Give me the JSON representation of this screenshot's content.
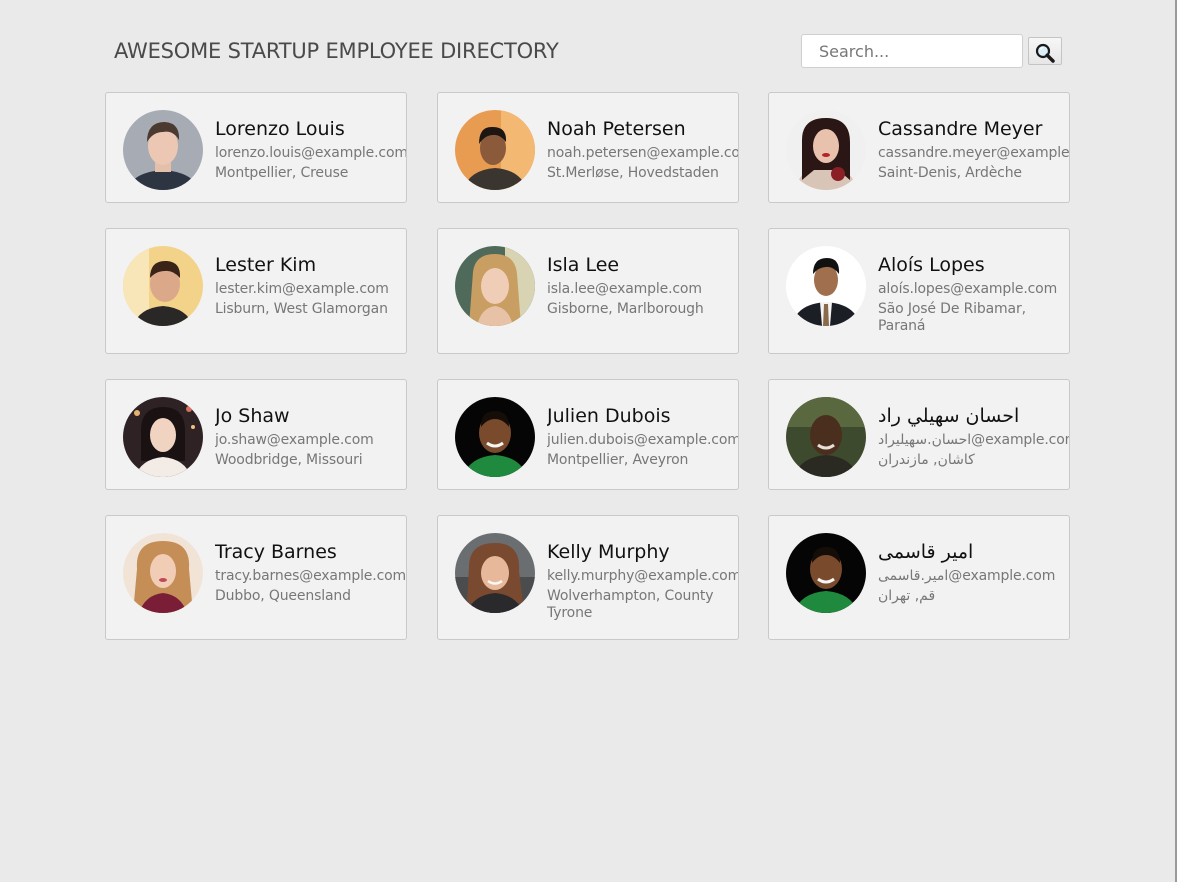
{
  "header": {
    "title": "AWESOME STARTUP EMPLOYEE DIRECTORY",
    "search_placeholder": "Search...",
    "search_button_icon": "magnifier-icon"
  },
  "employees": [
    {
      "name": "Lorenzo Louis",
      "email": "lorenzo.louis@example.com",
      "location": "Montpellier, Creuse"
    },
    {
      "name": "Noah Petersen",
      "email": "noah.petersen@example.com",
      "location": "St.Merløse, Hovedstaden"
    },
    {
      "name": "Cassandre Meyer",
      "email": "cassandre.meyer@example.com",
      "location": "Saint-Denis, Ardèche"
    },
    {
      "name": "Lester Kim",
      "email": "lester.kim@example.com",
      "location": "Lisburn, West Glamorgan"
    },
    {
      "name": "Isla Lee",
      "email": "isla.lee@example.com",
      "location": "Gisborne, Marlborough"
    },
    {
      "name": "Aloís Lopes",
      "email": "aloís.lopes@example.com",
      "location": "São José De Ribamar, Paraná"
    },
    {
      "name": "Jo Shaw",
      "email": "jo.shaw@example.com",
      "location": "Woodbridge, Missouri"
    },
    {
      "name": "Julien Dubois",
      "email": "julien.dubois@example.com",
      "location": "Montpellier, Aveyron"
    },
    {
      "name": "احسان سهيلي راد",
      "email": "احسان.سهیلیراد@example.com",
      "location": "كاشان, مازندران"
    },
    {
      "name": "Tracy Barnes",
      "email": "tracy.barnes@example.com",
      "location": "Dubbo, Queensland"
    },
    {
      "name": "Kelly Murphy",
      "email": "kelly.murphy@example.com",
      "location": "Wolverhampton, County Tyrone"
    },
    {
      "name": "امیر قاسمی",
      "email": "امیر.قاسمی@example.com",
      "location": "قم, تهران"
    }
  ],
  "colors": {
    "page_background": "#eaeaea",
    "card_background": "#f2f2f2",
    "card_border": "#c9c9c9",
    "name_text": "#111111",
    "secondary_text": "#777777",
    "title_text": "#4a4a4a"
  }
}
